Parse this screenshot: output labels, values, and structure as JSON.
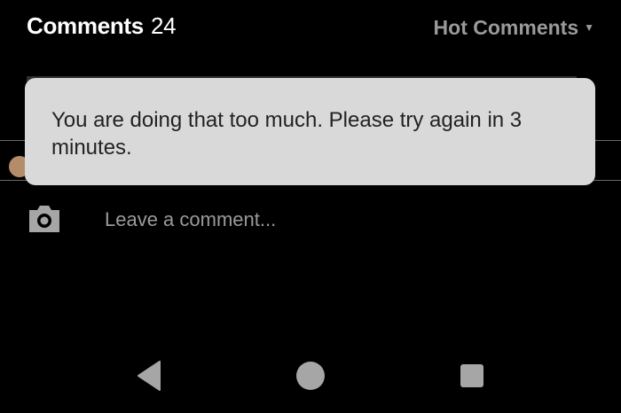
{
  "header": {
    "title": "Comments",
    "count": "24"
  },
  "sort": {
    "label": "Hot Comments",
    "caret_icon": "caret-down-icon"
  },
  "toast": {
    "message": "You are doing that too much. Please try again in 3 minutes."
  },
  "composer": {
    "camera_icon": "camera-icon",
    "placeholder": "Leave a comment..."
  },
  "nav": {
    "back_icon": "back-triangle-icon",
    "home_icon": "home-circle-icon",
    "recents_icon": "recents-square-icon"
  },
  "colors": {
    "background": "#000000",
    "toast_bg": "#d9d9d9",
    "muted": "#9a9a9a",
    "nav_icon": "#a6a6a6"
  }
}
